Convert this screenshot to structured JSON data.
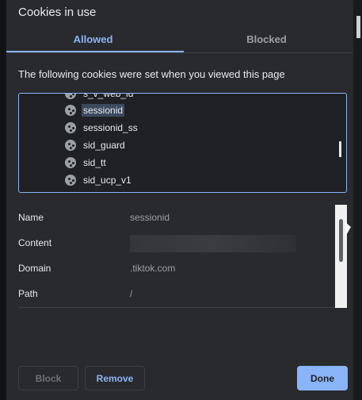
{
  "dialog": {
    "title": "Cookies in use",
    "tabs": [
      {
        "label": "Allowed",
        "active": true
      },
      {
        "label": "Blocked",
        "active": false
      }
    ],
    "description": "The following cookies were set when you viewed this page"
  },
  "tree": {
    "items": [
      {
        "label": "s_v_web_id",
        "selected": false
      },
      {
        "label": "sessionid",
        "selected": true
      },
      {
        "label": "sessionid_ss",
        "selected": false
      },
      {
        "label": "sid_guard",
        "selected": false
      },
      {
        "label": "sid_tt",
        "selected": false
      },
      {
        "label": "sid_ucp_v1",
        "selected": false
      }
    ]
  },
  "details": {
    "name_label": "Name",
    "name_value": "sessionid",
    "content_label": "Content",
    "domain_label": "Domain",
    "domain_value": ".tiktok.com",
    "path_label": "Path",
    "path_value": "/"
  },
  "buttons": {
    "block": "Block",
    "remove": "Remove",
    "done": "Done"
  },
  "colors": {
    "accent": "#8ab4f8",
    "dialog_bg": "#292a2d"
  }
}
